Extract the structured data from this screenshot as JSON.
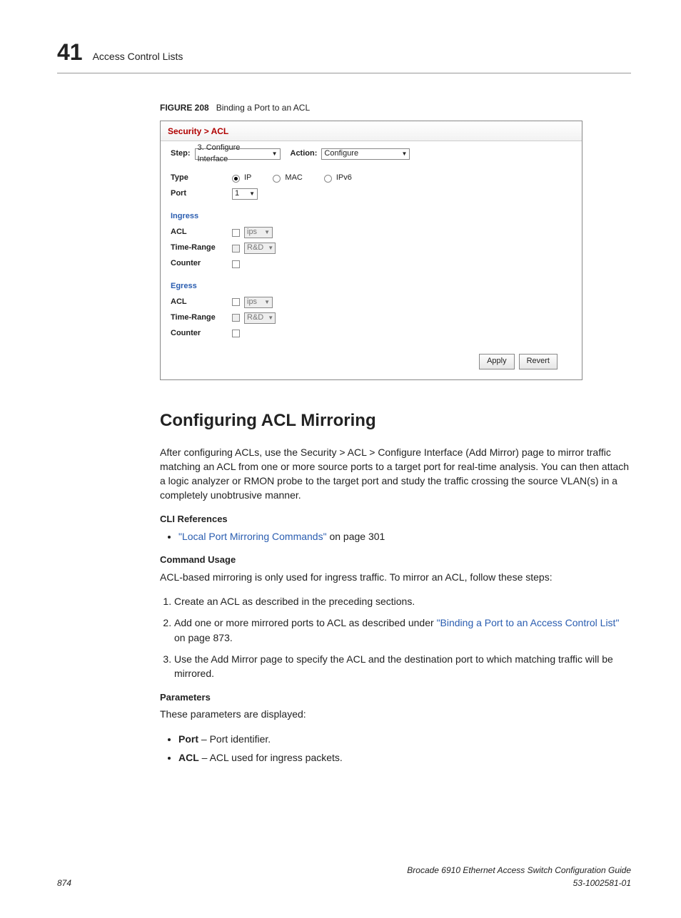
{
  "header": {
    "page_number": "41",
    "title": "Access Control Lists"
  },
  "figure": {
    "number": "FIGURE 208",
    "caption": "Binding a Port to an ACL",
    "breadcrumb": "Security > ACL",
    "step_label": "Step:",
    "step_value": "3. Configure Interface",
    "action_label": "Action:",
    "action_value": "Configure",
    "type_label": "Type",
    "type_options": {
      "ip": "IP",
      "mac": "MAC",
      "ipv6": "IPv6"
    },
    "port_label": "Port",
    "port_value": "1",
    "ingress_title": "Ingress",
    "egress_title": "Egress",
    "acl_label": "ACL",
    "acl_value": "ips",
    "tr_label": "Time-Range",
    "tr_value": "R&D",
    "counter_label": "Counter",
    "apply_btn": "Apply",
    "revert_btn": "Revert"
  },
  "section": {
    "title": "Configuring ACL Mirroring",
    "intro": "After configuring ACLs, use the Security > ACL > Configure Interface (Add Mirror) page to mirror traffic matching an ACL from one or more source ports to a target port for real-time analysis. You can then attach a logic analyzer or RMON probe to the target port and study the traffic crossing the source VLAN(s) in a completely unobtrusive manner.",
    "cli_title": "CLI References",
    "cli_link": "\"Local Port Mirroring Commands\"",
    "cli_suffix": " on page 301",
    "usage_title": "Command Usage",
    "usage_intro": "ACL-based mirroring is only used for ingress traffic. To mirror an ACL, follow these steps:",
    "steps": [
      "Create an ACL as described in the preceding sections.",
      {
        "pre": "Add one or more mirrored ports to ACL as described under ",
        "link": "\"Binding a Port to an Access Control List\"",
        "post": " on page 873."
      },
      "Use the Add Mirror page to specify the ACL and the destination port to which matching traffic will be mirrored."
    ],
    "params_title": "Parameters",
    "params_intro": "These parameters are displayed:",
    "params": [
      {
        "name": "Port",
        "desc": " – Port identifier."
      },
      {
        "name": "ACL",
        "desc": " – ACL used for ingress packets."
      }
    ]
  },
  "footer": {
    "left": "874",
    "right1": "Brocade 6910 Ethernet Access Switch Configuration Guide",
    "right2": "53-1002581-01"
  }
}
